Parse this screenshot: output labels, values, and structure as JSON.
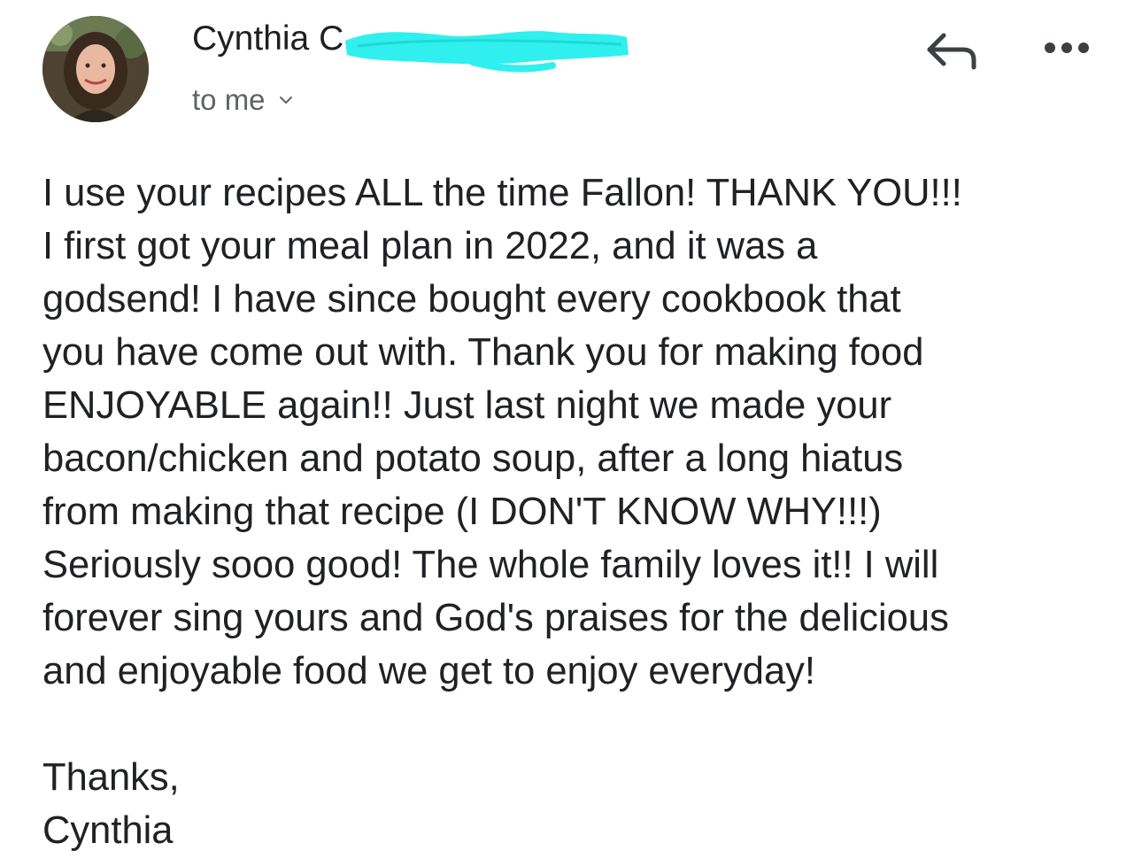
{
  "message": {
    "sender": {
      "name": "Cynthia C",
      "avatar_icon": "profile-photo"
    },
    "recipient": {
      "label": "to me",
      "expand_icon": "chevron-down-icon"
    },
    "actions": {
      "reply_icon": "reply-icon",
      "more_icon": "more-horizontal-icon"
    },
    "body_lines": [
      "I use your recipes ALL the time Fallon! THANK YOU!!!",
      "I first got your meal plan in 2022, and it was a",
      "godsend! I have since bought every cookbook that",
      "you have come out with. Thank you for making food",
      "ENJOYABLE again!! Just last night we made your",
      "bacon/chicken and potato soup, after a long hiatus",
      "from making that recipe (I DON'T KNOW WHY!!!)",
      "Seriously sooo good! The whole family loves it!! I will",
      "forever sing yours and God's praises for the delicious",
      "and enjoyable food we get to enjoy everyday!"
    ],
    "signoff": {
      "closing": "Thanks,",
      "signature": "Cynthia"
    }
  },
  "colors": {
    "redaction": "#2ff0ee",
    "text": "#202124",
    "secondary_text": "#5f6368"
  }
}
